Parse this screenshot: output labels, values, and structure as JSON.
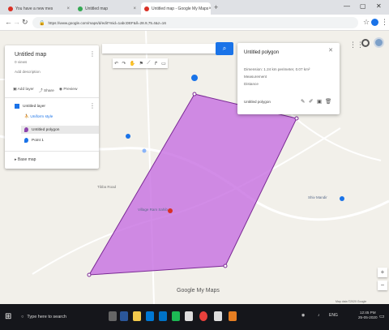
{
  "browser": {
    "tabs": [
      {
        "label": "You have a new mes",
        "favicon_color": "#d93025"
      },
      {
        "label": "Untitled map",
        "favicon_color": "#34a853"
      },
      {
        "label": "Untitled map - Google My Maps",
        "favicon_color": "#d93025"
      }
    ],
    "url": "https://www.google.com/maps/d/edit?mid=1abcDEF&ll=28.9,75.4&z=16",
    "new_tab": "+",
    "min": "—",
    "max": "▢",
    "close": "✕"
  },
  "panel": {
    "title": "Untitled map",
    "views": "0 views",
    "desc_placeholder": "Add description",
    "actions": {
      "add_layer": "Add layer",
      "share": "Share",
      "preview": "Preview"
    },
    "layer_name": "Untitled layer",
    "uniform_style": "Uniform style",
    "features": [
      {
        "label": "Untitled polygon",
        "color": "#8e44ad",
        "selected": true
      },
      {
        "label": "Point 1",
        "color": "#1a73e8",
        "selected": false
      }
    ],
    "base_map": "Base map"
  },
  "search": {
    "placeholder": "",
    "button": "⌕"
  },
  "toolbar": {
    "undo": "↶",
    "redo": "↷",
    "hand": "✋",
    "marker": "⚑",
    "line": "⟋",
    "route": "↱",
    "ruler": "▭"
  },
  "card": {
    "title": "Untitled polygon",
    "lines": [
      "Dimension: 1.24 km perimeter, 0.07 km²",
      "Measurement",
      "Distance"
    ],
    "footer": "Untitled polygon",
    "close": "✕"
  },
  "map": {
    "labels": [
      "Village Ram Sahib",
      "Tibba Road",
      "Shiv Mandir"
    ],
    "polygon_color": "#c56be0",
    "footer": "Google My Maps",
    "copyright": "Map data ©2020 Google"
  },
  "topright": {
    "grid": "⋮⋮",
    "zoom_in": "+",
    "zoom_out": "−"
  },
  "taskbar": {
    "search_placeholder": "Type here to search",
    "time": "12:45 PM",
    "date": "25-05-2020",
    "lang": "ENG"
  }
}
